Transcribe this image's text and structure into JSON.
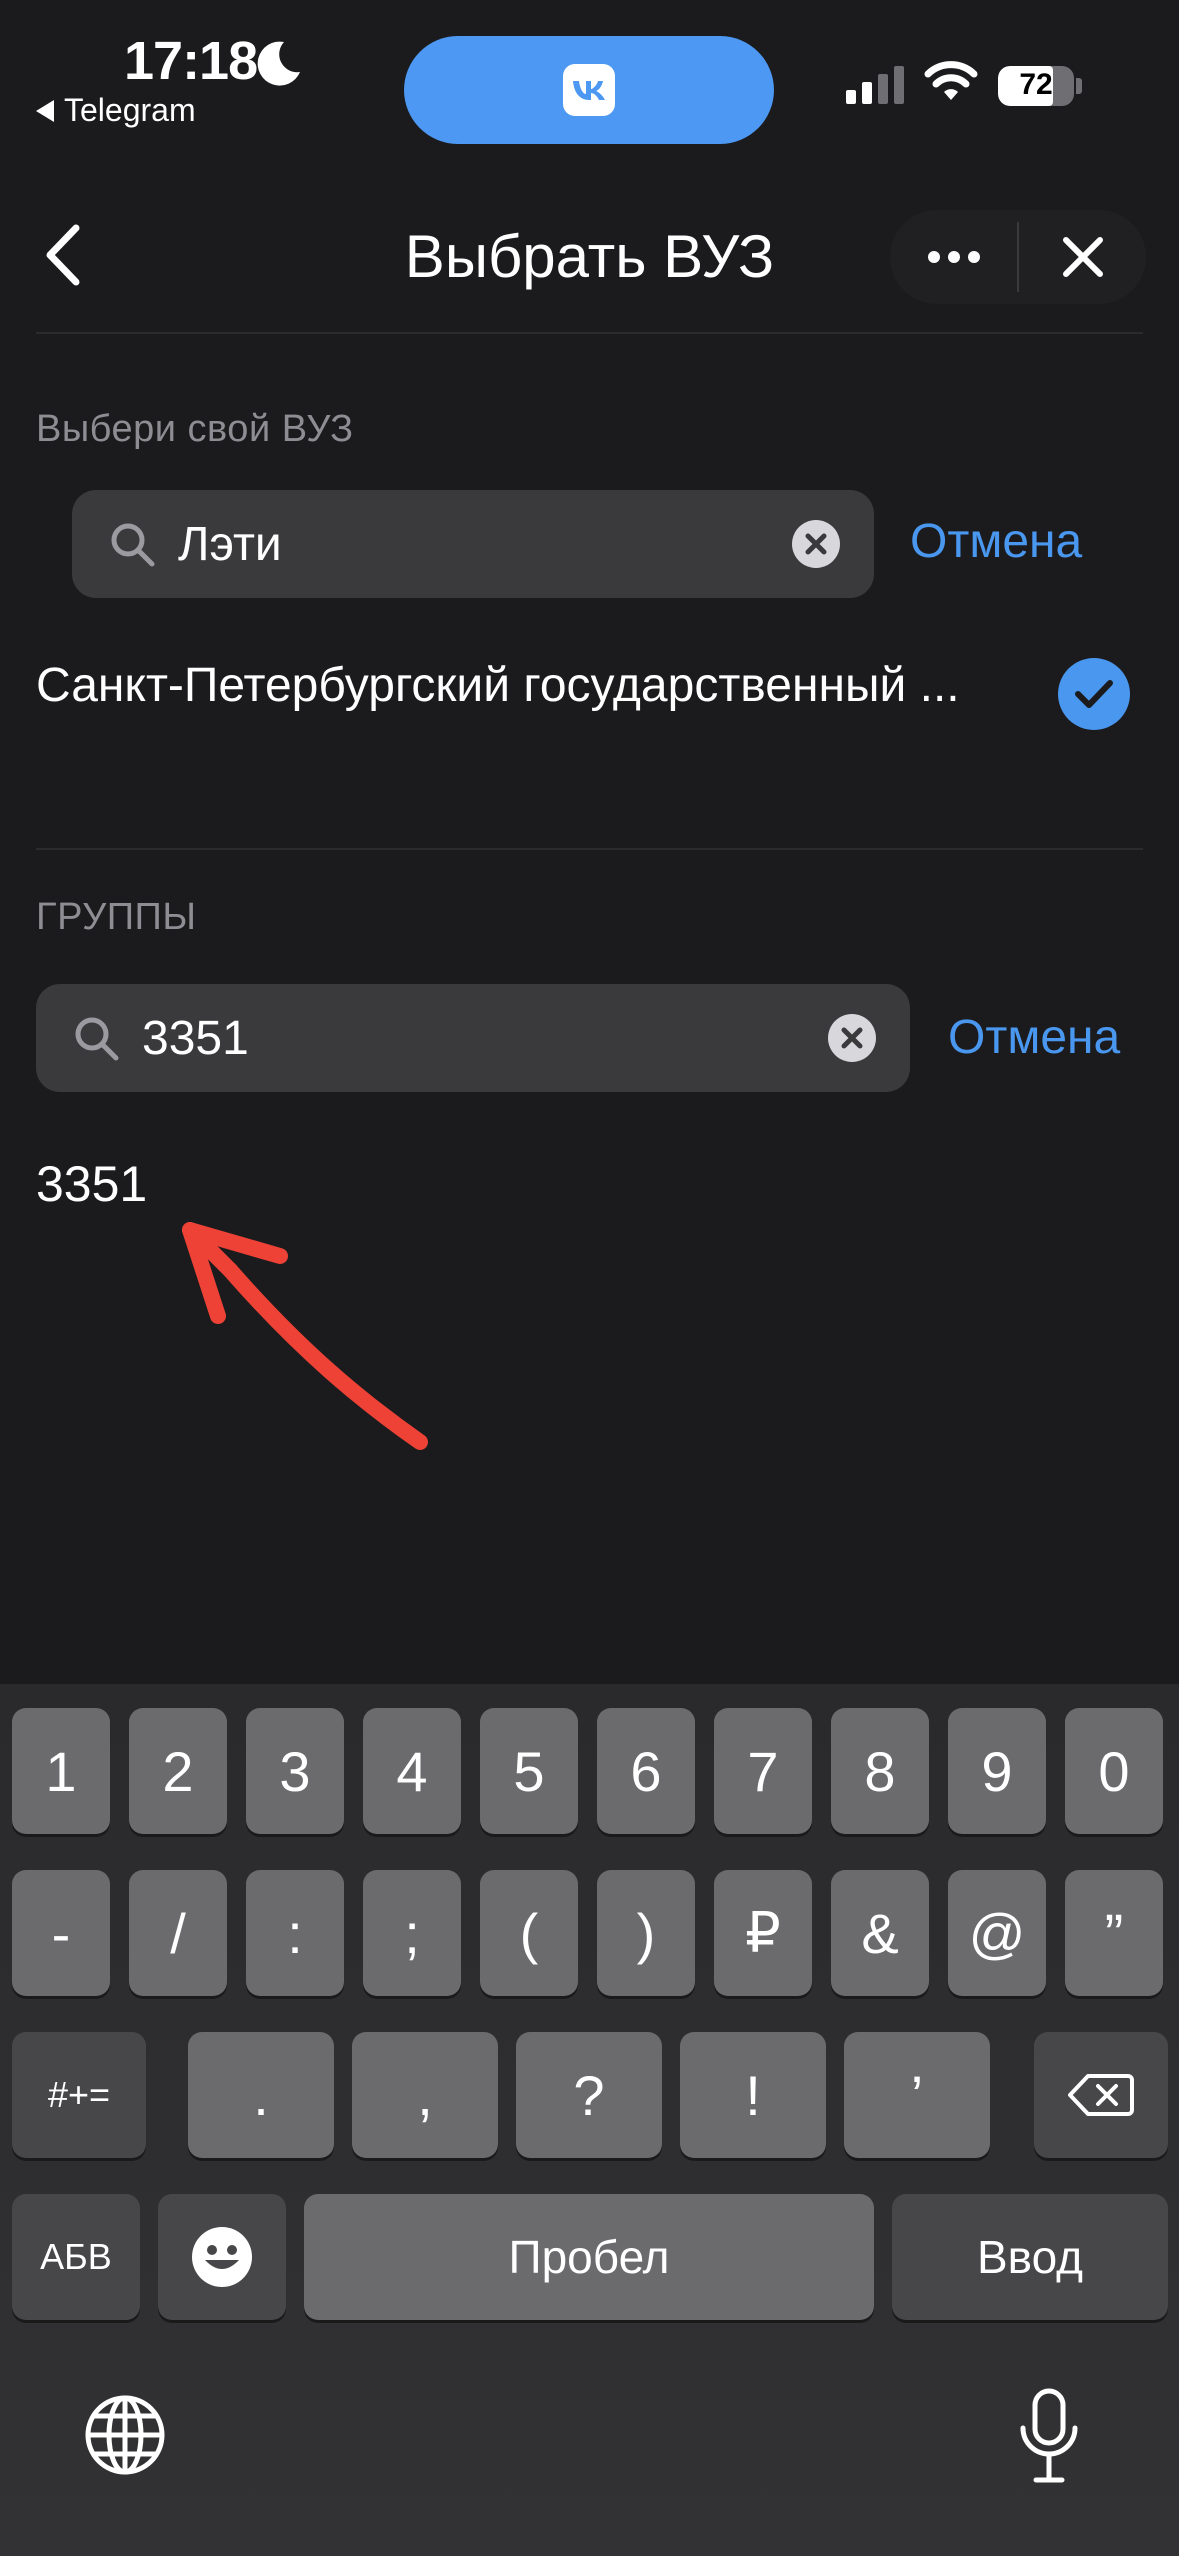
{
  "status_bar": {
    "time": "17:18",
    "back_app": "Telegram",
    "battery": "72",
    "battery_level": 0.72
  },
  "header": {
    "title": "Выбрать ВУЗ"
  },
  "university": {
    "label": "Выбери свой ВУЗ",
    "search_value": "Лэти",
    "cancel": "Отмена",
    "result": "Санкт-Петербургский государственный ..."
  },
  "groups": {
    "label": "ГРУППЫ",
    "search_value": "3351",
    "cancel": "Отмена",
    "result": "3351"
  },
  "keyboard": {
    "row1": [
      "1",
      "2",
      "3",
      "4",
      "5",
      "6",
      "7",
      "8",
      "9",
      "0"
    ],
    "row2": [
      "-",
      "/",
      ":",
      ";",
      "(",
      ")",
      "₽",
      "&",
      "@",
      "”"
    ],
    "row3": [
      ".",
      ",",
      "?",
      "!",
      "’"
    ],
    "mode_key": "#+=",
    "abc_key": "АБВ",
    "space": "Пробел",
    "enter": "Ввод"
  },
  "colors": {
    "accent": "#4a97f0",
    "background": "#1b1b1d",
    "annotation_arrow": "#ee4236"
  }
}
